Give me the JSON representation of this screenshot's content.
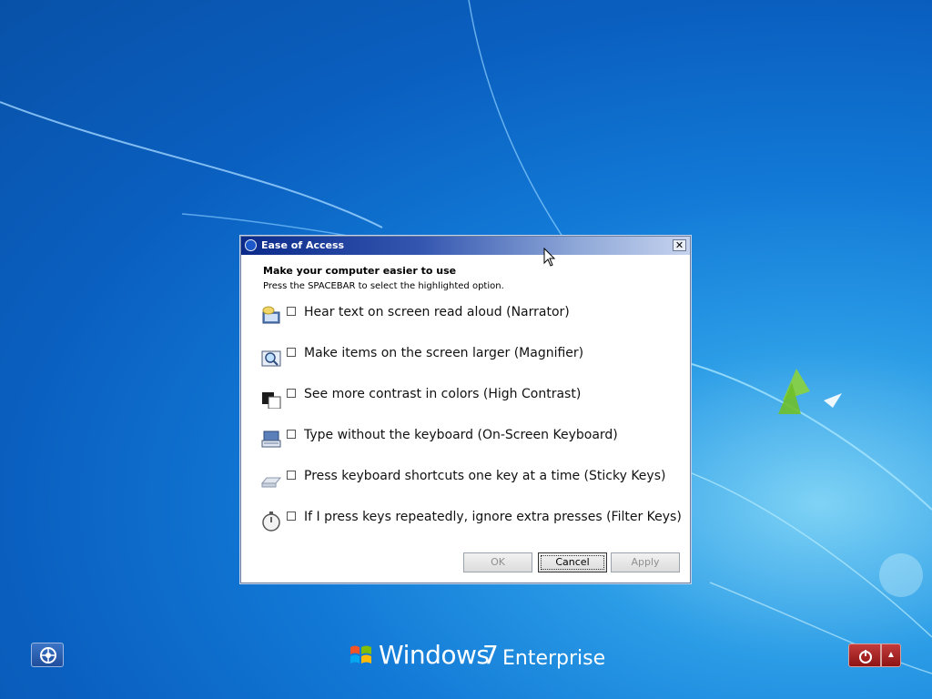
{
  "window": {
    "title": "Ease of Access",
    "close_glyph": "✕"
  },
  "dialog": {
    "heading": "Make your computer easier to use",
    "subheading": "Press the SPACEBAR to select the highlighted option.",
    "options": [
      {
        "label": "Hear text on screen read aloud (Narrator)",
        "icon": "narrator-icon",
        "checked": false
      },
      {
        "label": "Make items on the screen larger (Magnifier)",
        "icon": "magnifier-icon",
        "checked": false
      },
      {
        "label": "See more contrast in colors (High Contrast)",
        "icon": "high-contrast-icon",
        "checked": false
      },
      {
        "label": "Type without the keyboard (On-Screen Keyboard)",
        "icon": "on-screen-keyboard-icon",
        "checked": false
      },
      {
        "label": "Press keyboard shortcuts one key at a time (Sticky Keys)",
        "icon": "sticky-keys-icon",
        "checked": false
      },
      {
        "label": "If I press keys repeatedly, ignore extra presses (Filter Keys)",
        "icon": "filter-keys-icon",
        "checked": false
      }
    ],
    "buttons": {
      "ok": "OK",
      "cancel": "Cancel",
      "apply": "Apply"
    }
  },
  "branding": {
    "windows": "Windows",
    "version": "7",
    "edition": "Enterprise"
  },
  "colors": {
    "desktop": "#1279d6",
    "title_bar": "#0b2a8a",
    "shutdown": "#b12a2a"
  }
}
